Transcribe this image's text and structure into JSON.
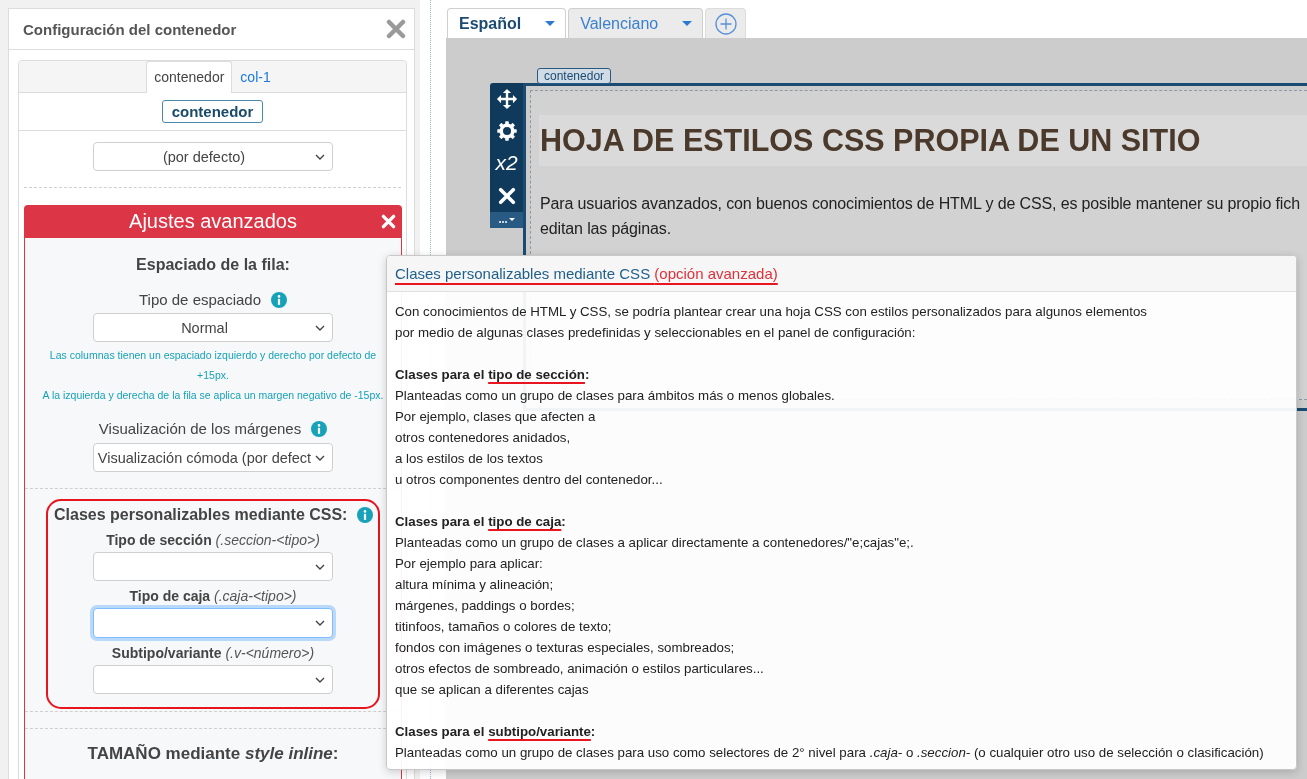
{
  "config_panel": {
    "title": "Configuración del contenedor",
    "tabs": [
      {
        "label": "contenedor",
        "selected": true
      },
      {
        "label": "col-1",
        "selected": false
      }
    ],
    "element_button": "contenedor",
    "style_select": {
      "value": "(por defecto)"
    },
    "advanced": {
      "title": "Ajustes avanzados",
      "row_spacing": {
        "heading": "Espaciado de la fila:",
        "fields": [
          {
            "label": "Tipo de espaciado",
            "info": true,
            "value": "Normal",
            "notes": [
              "Las columnas tienen un espaciado izquierdo y derecho por defecto de +15px.",
              "A la izquierda y derecha de la fila se aplica un margen negativo de -15px."
            ]
          },
          {
            "label": "Visualización de los márgenes",
            "info": true,
            "value": "Visualización cómoda (por defect"
          }
        ]
      },
      "css_classes": {
        "heading": "Clases personalizables mediante CSS:",
        "info": true,
        "highlighted": true,
        "fields": [
          {
            "label": "Tipo de sección",
            "hint": "(.seccion-<tipo>)",
            "focused": false
          },
          {
            "label": "Tipo de caja",
            "hint": "(.caja-<tipo>)",
            "focused": true
          },
          {
            "label": "Subtipo/variante",
            "hint": "(.v-<número>)",
            "focused": false
          }
        ]
      },
      "size_heading": "TAMAÑO mediante *style inline*:"
    }
  },
  "editor": {
    "language_tabs": [
      {
        "label": "Español",
        "selected": true
      },
      {
        "label": "Valenciano",
        "selected": false
      }
    ],
    "container": {
      "label": "contenedor",
      "toolbar_label": "x2",
      "heading": "HOJA DE ESTILOS CSS PROPIA DE UN SITIO",
      "paragraphs": [
        {
          "lines": [
            "Para usuarios avanzados, con buenos conocimientos de HTML y de CSS, es posible mantener su propio fich",
            "editan las páginas."
          ]
        }
      ]
    }
  },
  "popup": {
    "title": "Clases personalizables mediante CSS",
    "title_note": "(opción avanzada)",
    "intro": [
      "Con conocimientos de HTML y CSS, se podría plantear crear una hoja CSS con estilos personalizados para algunos elementos",
      "por medio de algunas clases predefinidas y seleccionables en el panel de configuración:"
    ],
    "sections": [
      {
        "lead": "Clases para el",
        "term": "tipo de sección",
        "tail": ":",
        "lines": [
          "Planteadas como un grupo de clases para ámbitos más o menos globales.",
          "Por ejemplo, clases que afecten a",
          "otros contenedores anidados,",
          "a los estilos de los textos",
          "u otros componentes dentro del contenedor..."
        ]
      },
      {
        "lead": "Clases para el",
        "term": "tipo de caja",
        "tail": ":",
        "lines": [
          "Planteadas como un grupo de clases a aplicar directamente a contenedores/\"e;cajas\"e;.",
          "Por ejemplo para aplicar:",
          "altura mínima y alineación;",
          "márgenes, paddings o bordes;",
          "titinfoos, tamaños o colores de texto;",
          "fondos con imágenes o texturas especiales, sombreados;",
          "otros efectos de sombreado, animación o estilos particulares...",
          "que se aplican a diferentes cajas"
        ]
      },
      {
        "lead": "Clases para el",
        "term": "subtipo/variante",
        "tail": ":",
        "lines": [
          "Planteadas como un grupo de clases para uso como selectores de 2° nivel para *.caja-* o *.seccion-* (o cualquier otro uso de selección o clasificación)"
        ]
      }
    ]
  }
}
